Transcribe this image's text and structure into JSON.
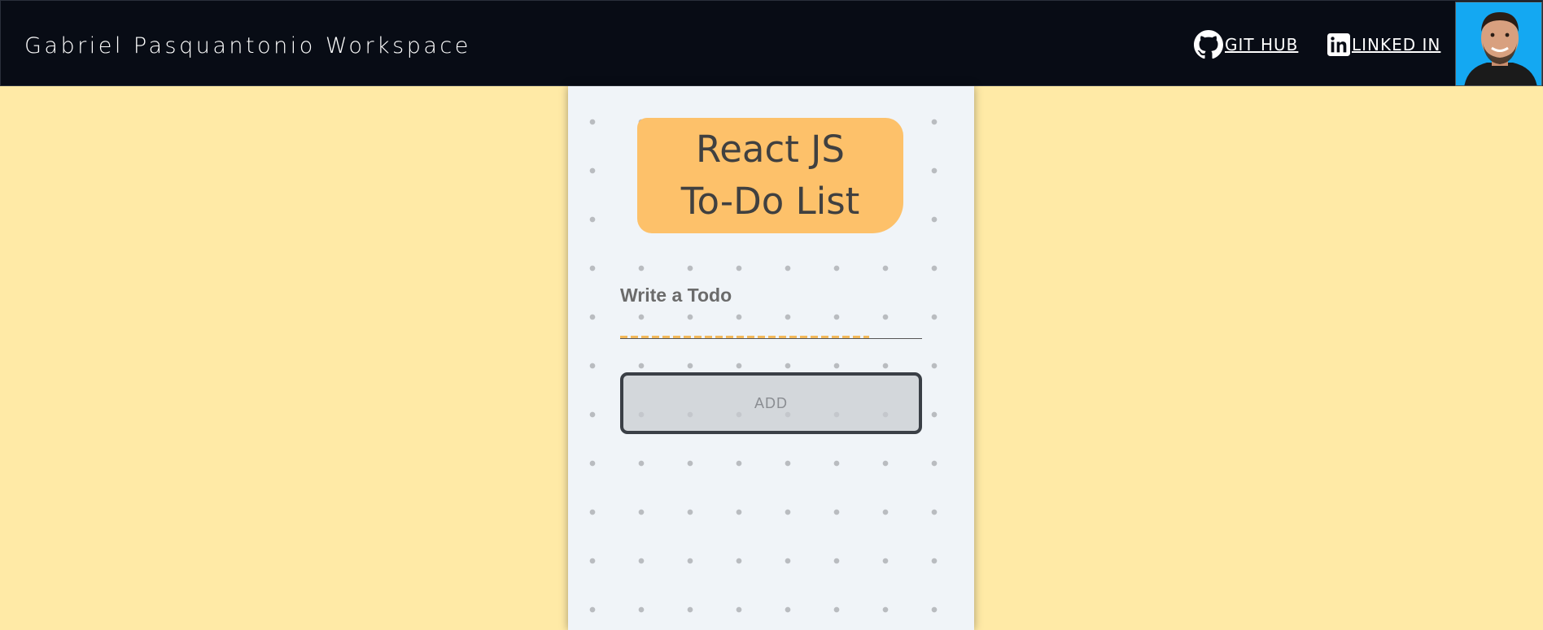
{
  "header": {
    "brand": "Gabriel Pasquantonio Workspace",
    "links": [
      {
        "label": "GIT HUB",
        "icon": "github-icon"
      },
      {
        "label": "LINKED IN",
        "icon": "linkedin-icon"
      }
    ],
    "avatar_bg": "#14a8f2"
  },
  "todo": {
    "title_line1": "React JS",
    "title_line2": "To-Do List",
    "input_label": "Write a Todo",
    "input_value": "",
    "add_label": "ADD"
  },
  "colors": {
    "page_bg": "#ffeaa6",
    "header_bg": "#080c15",
    "title_bg": "#fdc16a",
    "card_bg": "#f0f4f8"
  }
}
